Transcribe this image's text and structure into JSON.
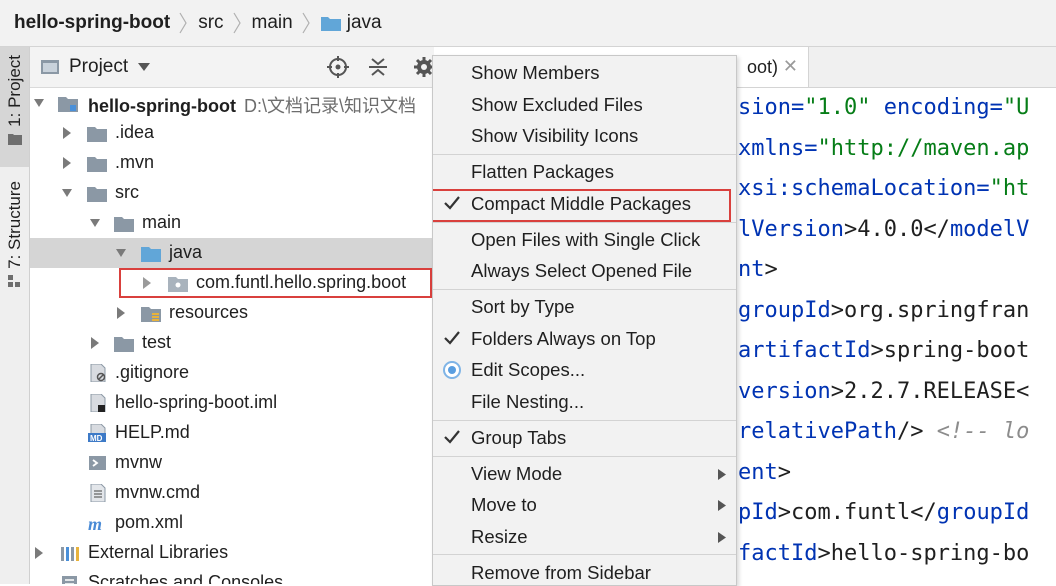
{
  "breadcrumb": {
    "items": [
      "hello-spring-boot",
      "src",
      "main",
      "java"
    ]
  },
  "left_strip": {
    "project_tab": "1: Project",
    "structure_tab": "7: Structure"
  },
  "project_panel": {
    "title": "Project",
    "tree": [
      {
        "label": "hello-spring-boot",
        "hint": "D:\\文档记录\\知识文档",
        "icon": "module-folder-icon",
        "bold": true,
        "expanded": true
      },
      {
        "label": ".idea",
        "icon": "folder-icon"
      },
      {
        "label": ".mvn",
        "icon": "folder-icon"
      },
      {
        "label": "src",
        "icon": "folder-icon",
        "expanded": true
      },
      {
        "label": "main",
        "icon": "folder-icon",
        "expanded": true
      },
      {
        "label": "java",
        "icon": "source-folder-icon",
        "expanded": true,
        "selected": true
      },
      {
        "label": "com.funtl.hello.spring.boot",
        "icon": "package-icon",
        "highlighted": true
      },
      {
        "label": "resources",
        "icon": "resources-folder-icon"
      },
      {
        "label": "test",
        "icon": "folder-icon"
      },
      {
        "label": ".gitignore",
        "icon": "ignored-file-icon"
      },
      {
        "label": "hello-spring-boot.iml",
        "icon": "iml-file-icon"
      },
      {
        "label": "HELP.md",
        "icon": "markdown-file-icon"
      },
      {
        "label": "mvnw",
        "icon": "shell-file-icon"
      },
      {
        "label": "mvnw.cmd",
        "icon": "text-file-icon"
      },
      {
        "label": "pom.xml",
        "icon": "maven-icon"
      },
      {
        "label": "External Libraries",
        "icon": "libraries-icon"
      },
      {
        "label": "Scratches and Consoles",
        "icon": "scratches-icon"
      }
    ]
  },
  "editor": {
    "tab_label": "oot)",
    "lines": [
      [
        {
          "t": "sion=",
          "c": "attr"
        },
        {
          "t": "\"1.0\"",
          "c": "str"
        },
        {
          "t": " encoding=",
          "c": "attr"
        },
        {
          "t": "\"U",
          "c": "str"
        }
      ],
      [
        {
          "t": "xmlns=",
          "c": "attr"
        },
        {
          "t": "\"http://maven.ap",
          "c": "str"
        }
      ],
      [
        {
          "t": "xsi:schemaLocation=",
          "c": "attr"
        },
        {
          "t": "\"ht",
          "c": "str"
        }
      ],
      [
        {
          "t": "lVersion",
          "c": "tag"
        },
        {
          "t": ">4.0.0</",
          "c": "plain"
        },
        {
          "t": "modelV",
          "c": "tag"
        }
      ],
      [
        {
          "t": "nt",
          "c": "tag"
        },
        {
          "t": ">",
          "c": "plain"
        }
      ],
      [
        {
          "t": "groupId",
          "c": "tag"
        },
        {
          "t": ">org.springfran",
          "c": "plain"
        }
      ],
      [
        {
          "t": "artifactId",
          "c": "tag"
        },
        {
          "t": ">spring-boot",
          "c": "plain"
        }
      ],
      [
        {
          "t": "version",
          "c": "tag"
        },
        {
          "t": ">2.2.7.RELEASE<",
          "c": "plain"
        }
      ],
      [
        {
          "t": "relativePath",
          "c": "tag"
        },
        {
          "t": "/> ",
          "c": "plain"
        },
        {
          "t": "<!-- lo",
          "c": "cmt"
        }
      ],
      [
        {
          "t": "ent",
          "c": "tag"
        },
        {
          "t": ">",
          "c": "plain"
        }
      ],
      [
        {
          "t": "pId",
          "c": "tag"
        },
        {
          "t": ">com.funtl</",
          "c": "plain"
        },
        {
          "t": "groupId",
          "c": "tag"
        }
      ],
      [
        {
          "t": "factId",
          "c": "tag"
        },
        {
          "t": ">hello-spring-bo",
          "c": "plain"
        }
      ]
    ]
  },
  "context_menu": {
    "items": [
      {
        "label": "Show Members"
      },
      {
        "label": "Show Excluded Files"
      },
      {
        "label": "Show Visibility Icons"
      },
      {
        "label": "Flatten Packages"
      },
      {
        "label": "Compact Middle Packages",
        "checked": true,
        "highlighted": true
      },
      {
        "label": "Open Files with Single Click"
      },
      {
        "label": "Always Select Opened File"
      },
      {
        "label": "Sort by Type"
      },
      {
        "label": "Folders Always on Top",
        "checked": true
      },
      {
        "label": "Edit Scopes...",
        "radio": true
      },
      {
        "label": "File Nesting..."
      },
      {
        "label": "Group Tabs",
        "checked": true
      },
      {
        "label": "View Mode",
        "submenu": true
      },
      {
        "label": "Move to",
        "submenu": true
      },
      {
        "label": "Resize",
        "submenu": true
      },
      {
        "label": "Remove from Sidebar"
      }
    ]
  },
  "colors": {
    "highlight_border": "#d9403d",
    "tag": "#0033b3",
    "string": "#067d17",
    "folder": "#8b98a5",
    "source_folder": "#61a6d8"
  }
}
